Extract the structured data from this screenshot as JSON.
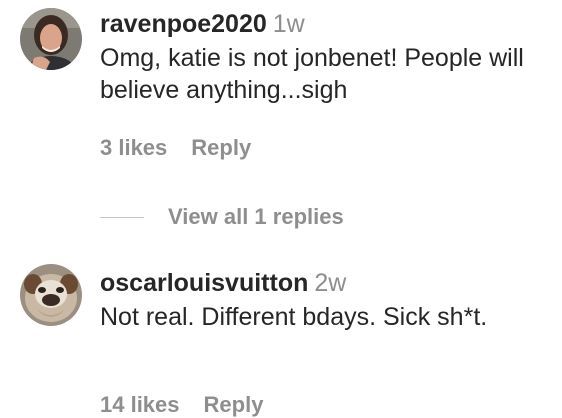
{
  "comments": [
    {
      "username": "ravenpoe2020",
      "time": "1w",
      "text": "Omg, katie is not jonbenet! People will believe anything...sigh",
      "likes": "3 likes",
      "reply": "Reply",
      "view_replies": "View all 1 replies",
      "avatar_icon": "user-avatar-woman"
    },
    {
      "username": "oscarlouisvuitton",
      "time": "2w",
      "text": "Not real. Different bdays. Sick sh*t.",
      "likes": "14 likes",
      "reply": "Reply",
      "avatar_icon": "user-avatar-bulldog"
    }
  ],
  "colors": {
    "primary_text": "#262626",
    "secondary_text": "#8e8e8e",
    "divider": "#c7c7c7"
  }
}
